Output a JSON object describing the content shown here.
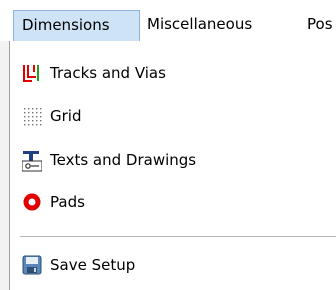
{
  "menubar": {
    "dimensions": "Dimensions",
    "miscellaneous": "Miscellaneous",
    "partial": "Pos"
  },
  "menu": {
    "items": [
      {
        "label": "Tracks and Vias",
        "icon": "tracks-vias-icon"
      },
      {
        "label": "Grid",
        "icon": "grid-icon"
      },
      {
        "label": "Texts and Drawings",
        "icon": "texts-drawings-icon"
      },
      {
        "label": "Pads",
        "icon": "pad-icon"
      },
      {
        "label": "Save Setup",
        "icon": "save-disk-icon"
      }
    ]
  },
  "colors": {
    "active_menubar_bg": "#cfe3f7",
    "active_menubar_border": "#8fb5dd",
    "tracks_red": "#e00000",
    "tracks_green": "#20a020",
    "pad_red": "#e00000",
    "save_blue": "#5a87b8"
  }
}
